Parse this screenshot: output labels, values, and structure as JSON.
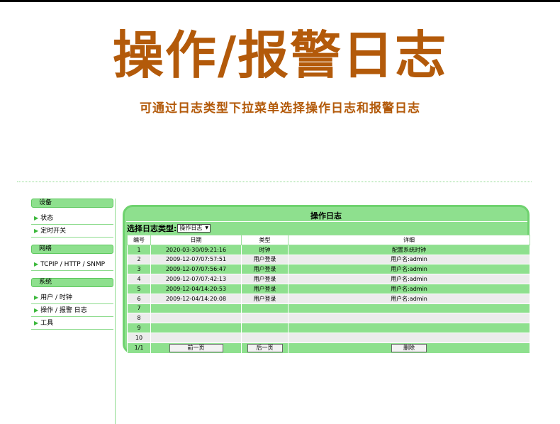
{
  "hero": {
    "title": "操作/报警日志",
    "subtitle": "可通过日志类型下拉菜单选择操作日志和报警日志"
  },
  "sidebar": {
    "sections": [
      {
        "label": "设备",
        "items": [
          "状态",
          "定时开关"
        ]
      },
      {
        "label": "网络",
        "items": [
          "TCPIP / HTTP / SNMP"
        ]
      },
      {
        "label": "系统",
        "items": [
          "用户 / 时钟",
          "操作 / 报警 日志",
          "工具"
        ]
      }
    ]
  },
  "panel": {
    "title": "操作日志",
    "type_label": "选择日志类型:",
    "type_value": "操作日志",
    "columns": [
      "编号",
      "日期",
      "类型",
      "详细"
    ],
    "rows": [
      [
        "1",
        "2020-03-30/09:21:16",
        "时钟",
        "配置系统时钟"
      ],
      [
        "2",
        "2009-12-07/07:57:51",
        "用户登录",
        "用户名:admin"
      ],
      [
        "3",
        "2009-12-07/07:56:47",
        "用户登录",
        "用户名:admin"
      ],
      [
        "4",
        "2009-12-07/07:42:13",
        "用户登录",
        "用户名:admin"
      ],
      [
        "5",
        "2009-12-04/14:20:53",
        "用户登录",
        "用户名:admin"
      ],
      [
        "6",
        "2009-12-04/14:20:08",
        "用户登录",
        "用户名:admin"
      ],
      [
        "7",
        "",
        "",
        ""
      ],
      [
        "8",
        "",
        "",
        ""
      ],
      [
        "9",
        "",
        "",
        ""
      ],
      [
        "10",
        "",
        "",
        ""
      ]
    ],
    "footer": {
      "page": "1/1",
      "prev_label": "前一页",
      "next_label": "后一页",
      "delete_label": "删除"
    }
  },
  "colors": {
    "accent_brown": "#b35a0a",
    "panel_green": "#8ee08e",
    "border_green": "#6fd26f",
    "row_gray": "#ececec"
  }
}
